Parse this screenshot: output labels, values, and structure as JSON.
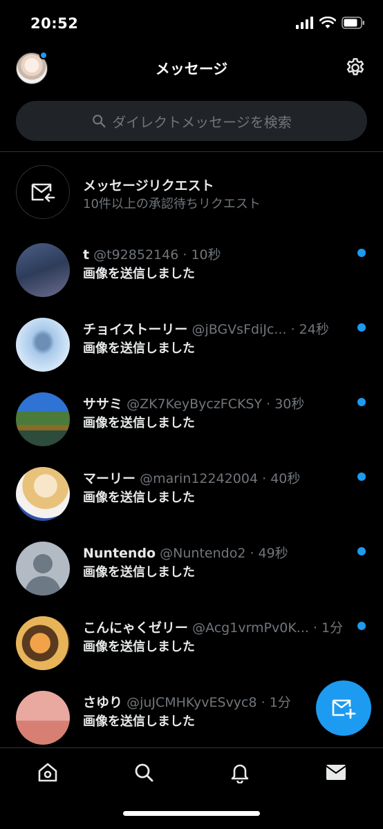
{
  "status": {
    "time": "20:52"
  },
  "header": {
    "title": "メッセージ"
  },
  "search": {
    "placeholder": "ダイレクトメッセージを検索"
  },
  "requests": {
    "title": "メッセージリクエスト",
    "subtitle": "10件以上の承認待ちリクエスト"
  },
  "messages": [
    {
      "name": "t",
      "handle": "@t92852146",
      "time": "· 10秒",
      "preview": "画像を送信しました"
    },
    {
      "name": "チョイストーリー",
      "handle": "@jBGVsFdiJc...",
      "time": "· 24秒",
      "preview": "画像を送信しました"
    },
    {
      "name": "ササミ",
      "handle": "@ZK7KeyByczFCKSY",
      "time": "· 30秒",
      "preview": "画像を送信しました"
    },
    {
      "name": "マーリー",
      "handle": "@marin12242004",
      "time": "· 40秒",
      "preview": "画像を送信しました"
    },
    {
      "name": "Nuntendo",
      "handle": "@Nuntendo2",
      "time": "· 49秒",
      "preview": "画像を送信しました"
    },
    {
      "name": "こんにゃくゼリー",
      "handle": "@Acg1vrmPv0K...",
      "time": "· 1分",
      "preview": "画像を送信しました"
    },
    {
      "name": "さゆり",
      "handle": "@juJCMHKyvESvyc8",
      "time": "· 1分",
      "preview": "画像を送信しました"
    }
  ],
  "icons": {
    "gear": "gear-icon",
    "search": "search-icon",
    "request": "mail-request-icon",
    "compose": "compose-message-icon",
    "nav": [
      "home-icon",
      "search-icon",
      "bell-icon",
      "mail-icon"
    ]
  },
  "colors": {
    "accent": "#1d9bf0",
    "background": "#000000",
    "secondary_text": "#71767b"
  }
}
